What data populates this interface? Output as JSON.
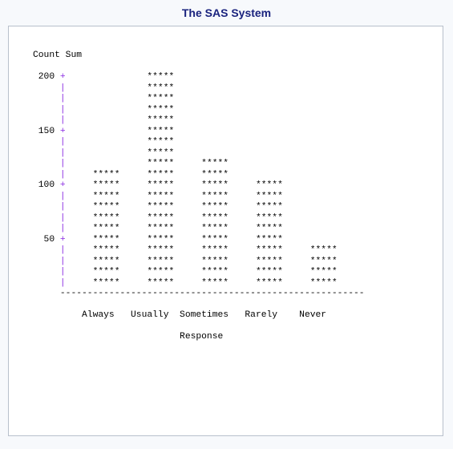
{
  "title": "The SAS System",
  "ylabel": "Count Sum",
  "xlabel": "Response",
  "y_ticks": [
    200,
    150,
    100,
    50
  ],
  "categories": [
    "Always",
    "Usually",
    "Sometimes",
    "Rarely",
    "Never"
  ],
  "chart_data": {
    "type": "bar",
    "categories": [
      "Always",
      "Usually",
      "Sometimes",
      "Rarely",
      "Never"
    ],
    "values": [
      110,
      200,
      120,
      100,
      40
    ],
    "title": "",
    "xlabel": "Response",
    "ylabel": "Count Sum",
    "ylim": [
      0,
      200
    ],
    "y_ticks": [
      50,
      100,
      150,
      200
    ],
    "bar_symbol": "*****",
    "row_step": 10
  }
}
